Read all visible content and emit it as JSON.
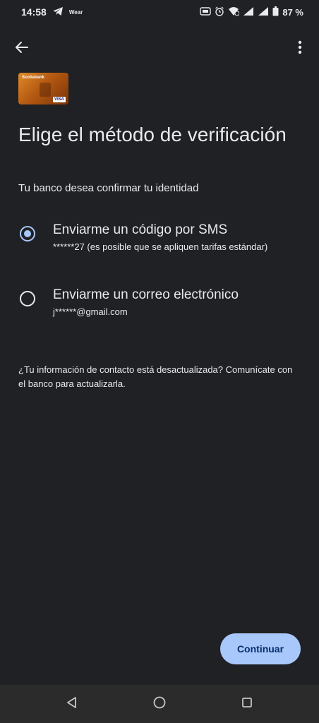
{
  "status_bar": {
    "time": "14:58",
    "wear_label": "Wear",
    "battery": "87 %"
  },
  "card": {
    "bank_name": "Scotiabank",
    "network": "VISA"
  },
  "page": {
    "title": "Elige el método de verificación",
    "subtitle": "Tu banco desea confirmar tu identidad"
  },
  "options": [
    {
      "title": "Enviarme un código por SMS",
      "detail": "******27 (es posible que se apliquen tarifas estándar)",
      "selected": true
    },
    {
      "title": "Enviarme un correo electrónico",
      "detail": "j******@gmail.com",
      "selected": false
    }
  ],
  "info": {
    "text": "¿Tu información de contacto está desactualizada? Comunícate con el banco para actualizarla."
  },
  "actions": {
    "continue_label": "Continuar"
  },
  "colors": {
    "background": "#202124",
    "accent": "#a8c7fa",
    "accent_text": "#062e6f",
    "text": "#e8eaed"
  },
  "icons": {
    "telegram": "telegram-icon",
    "back": "arrow-left-icon",
    "more": "more-vert-icon",
    "nav_back": "triangle-back-icon",
    "nav_home": "circle-home-icon",
    "nav_recents": "square-recents-icon"
  }
}
